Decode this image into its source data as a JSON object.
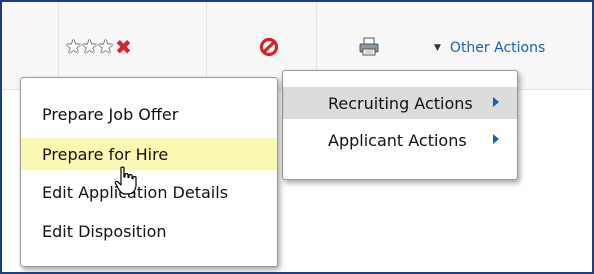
{
  "toolbar": {
    "rating_icon": "rating-stars-icon",
    "rating_stars_filled": 0,
    "rating_stars_total": 3,
    "clear_rating_icon": "x-mark-icon",
    "no_icon": "prohibited-icon",
    "print_icon": "printer-icon",
    "other_actions_label": "Other Actions"
  },
  "primary_menu": {
    "items": [
      {
        "label": "Prepare Job Offer"
      },
      {
        "label": "Prepare for Hire"
      },
      {
        "label": "Edit Application Details"
      },
      {
        "label": "Edit Disposition"
      }
    ]
  },
  "sub_menu": {
    "items": [
      {
        "label": "Recruiting Actions"
      },
      {
        "label": "Applicant Actions"
      }
    ]
  },
  "colors": {
    "frame_border": "#1a3f7a",
    "link_blue": "#1a5fb4",
    "highlight_yellow": "#fbf8b4",
    "hover_gray": "#dcdcdc",
    "icon_red": "#d4232a"
  }
}
